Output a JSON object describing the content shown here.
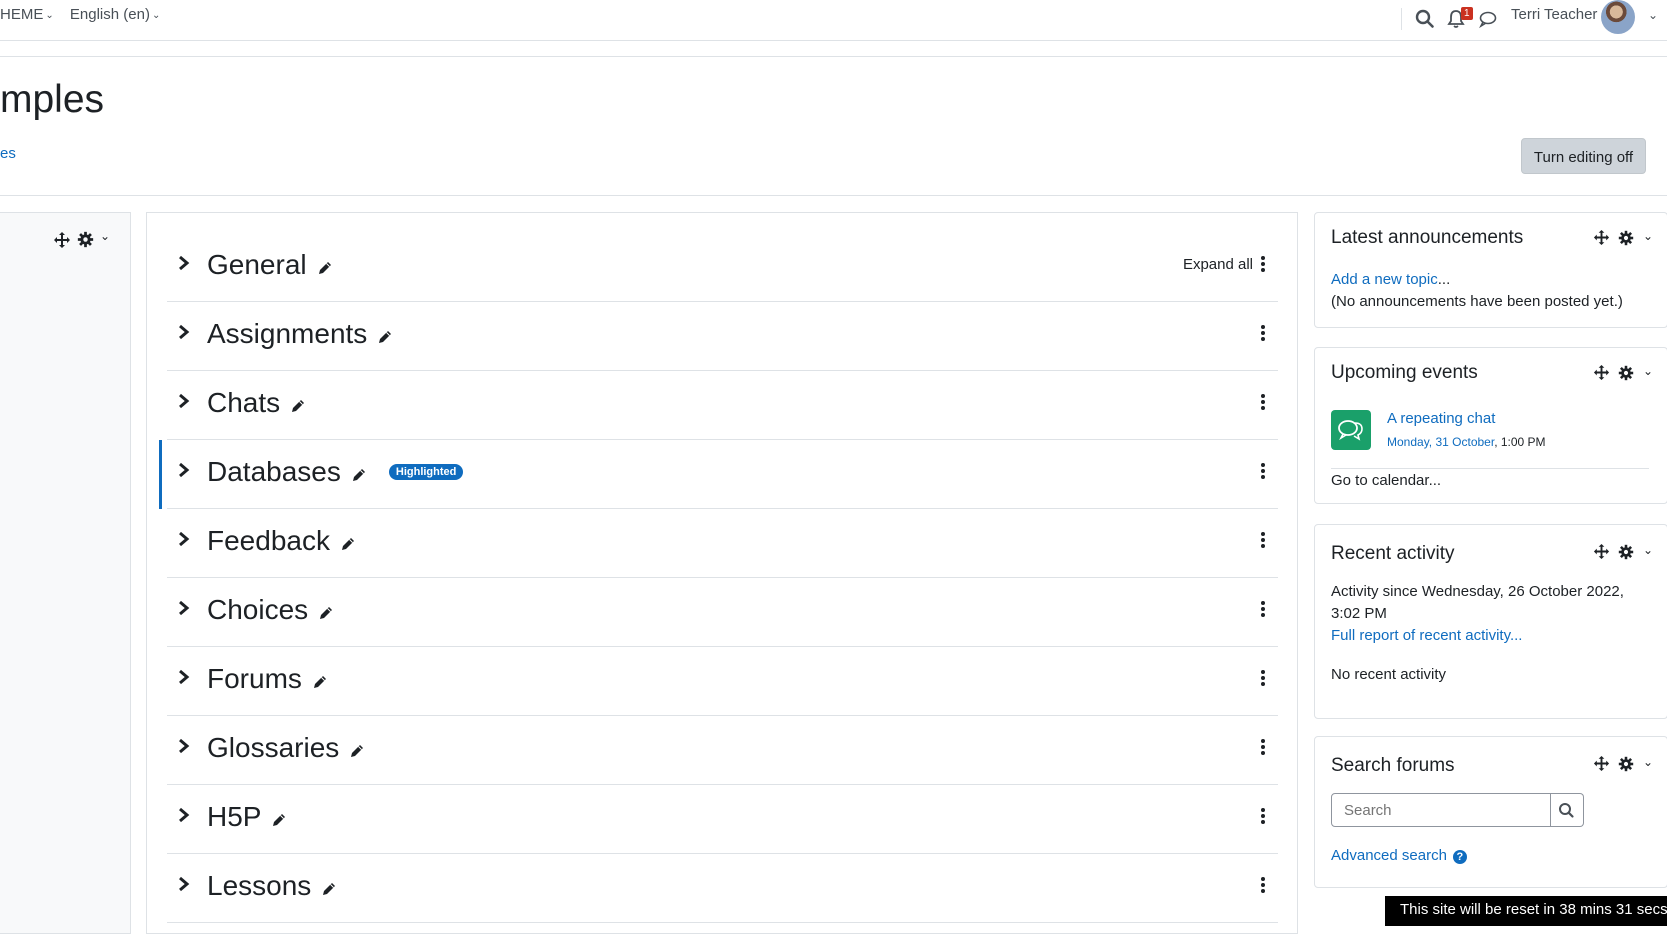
{
  "navbar": {
    "theme_menu": "HEME",
    "language_menu": "English (en)",
    "notification_count": "1",
    "user_name": "Terri Teacher"
  },
  "page": {
    "title": "mples",
    "link": "es",
    "editing_button": "Turn editing off"
  },
  "course": {
    "expand_all": "Expand all",
    "highlight_badge": "Highlighted",
    "sections": [
      "General",
      "Assignments",
      "Chats",
      "Databases",
      "Feedback",
      "Choices",
      "Forums",
      "Glossaries",
      "H5P",
      "Lessons"
    ],
    "highlighted_section": "Databases"
  },
  "blocks": {
    "announcements": {
      "title": "Latest announcements",
      "add_link": "Add a new topic",
      "add_suffix": "...",
      "empty_text": "(No announcements have been posted yet.)"
    },
    "upcoming": {
      "title": "Upcoming events",
      "event_name": "A repeating chat",
      "event_date": "Monday, 31 October",
      "event_time": ", 1:00 PM",
      "calendar_link": "Go to calendar..."
    },
    "recent": {
      "title": "Recent activity",
      "since_line1": "Activity since Wednesday, 26 October 2022,",
      "since_line2": "3:02 PM",
      "report_link": "Full report of recent activity...",
      "none_text": "No recent activity"
    },
    "search": {
      "title": "Search forums",
      "placeholder": "Search",
      "advanced_link": "Advanced search"
    }
  },
  "footer": {
    "reset_notice": "This site will be reset in 38 mins 31 secs"
  },
  "colors": {
    "link": "#0f6cbf",
    "highlight_bar": "#0f6cbf",
    "event_icon": "#1aa06a",
    "notification_badge": "#ca3120"
  }
}
